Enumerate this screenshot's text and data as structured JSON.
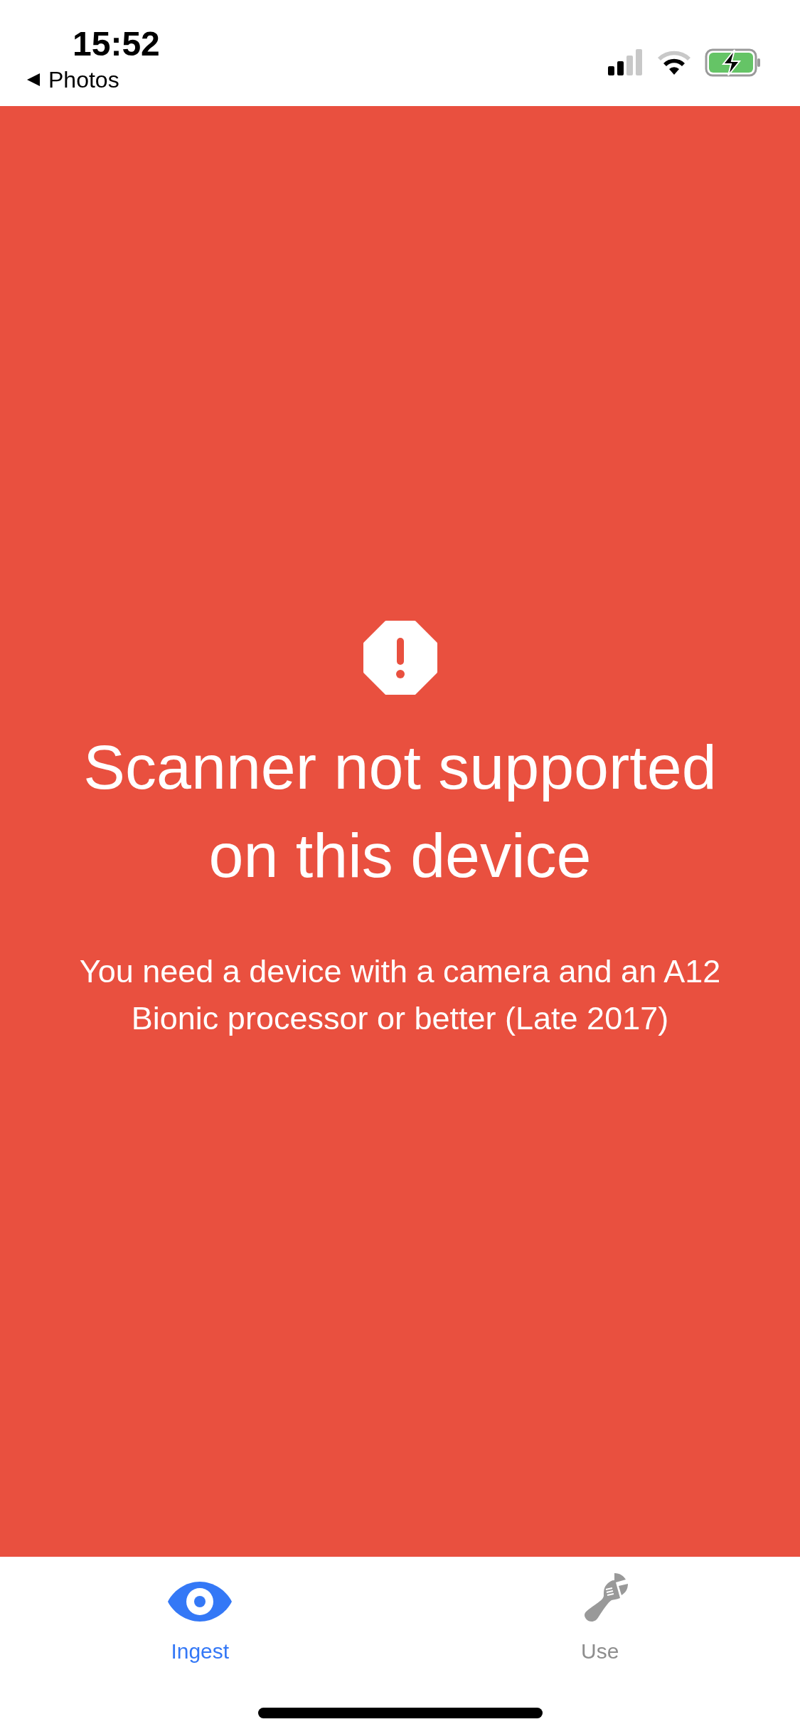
{
  "status_bar": {
    "time": "15:52",
    "back_label": "Photos"
  },
  "error": {
    "title": "Scanner not supported on this device",
    "message": "You need a device with a camera and an A12 Bionic processor or better (Late 2017)"
  },
  "tabs": [
    {
      "kind": "eye",
      "label": "Ingest",
      "selected": true
    },
    {
      "kind": "wrench",
      "label": "Use",
      "selected": false
    }
  ]
}
